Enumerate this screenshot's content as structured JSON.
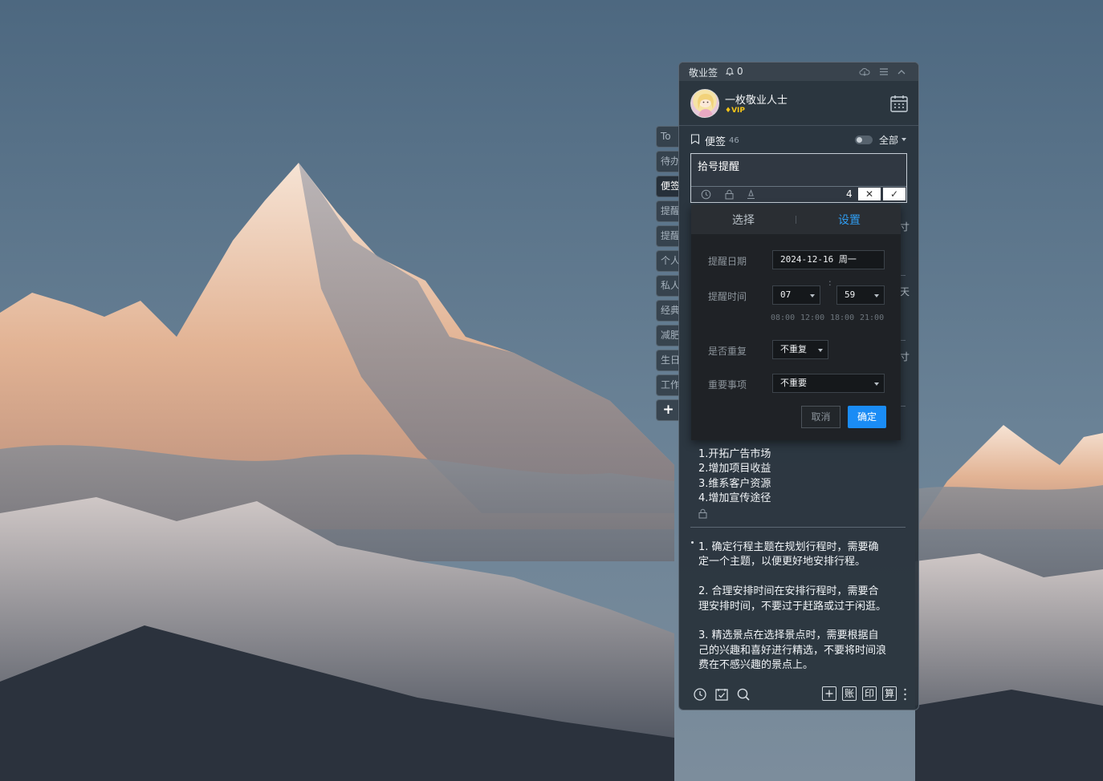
{
  "desktop": {
    "wallpaper": "snow-capped-mountain-peak-at-sunrise"
  },
  "side_tabs": [
    "To",
    "待办",
    "便签",
    "提醒",
    "提醒",
    "个人",
    "私人",
    "经典",
    "减肥",
    "生日",
    "工作",
    "+"
  ],
  "app": {
    "title": "敬业签",
    "notification_count": "0",
    "user": {
      "name": "一枚敬业人士",
      "badge": "VIP"
    },
    "notes_label": "便签",
    "notes_count": "46",
    "filter": "全部",
    "editor": {
      "text": "拾号提醒",
      "char_count": "4",
      "cancel_glyph": "✕",
      "confirm_glyph": "✓"
    },
    "side_fragments": [
      "寸",
      "天",
      "寸"
    ],
    "reminder_popup": {
      "tabs": [
        "选择",
        "设置"
      ],
      "active_tab": "设置",
      "date_label": "提醒日期",
      "date_value": "2024-12-16 周一",
      "time_label": "提醒时间",
      "hour": "07",
      "minute": "59",
      "time_separator": ":",
      "quick_times": [
        "08:00",
        "12:00",
        "18:00",
        "21:00"
      ],
      "repeat_label": "是否重复",
      "repeat_value": "不重复",
      "importance_label": "重要事项",
      "importance_value": "不重要",
      "cancel": "取消",
      "confirm": "确定"
    },
    "notes": [
      {
        "lines": [
          "1.开拓广告市场",
          "2.增加项目收益",
          "3.维系客户资源",
          "4.增加宣传途径"
        ]
      },
      {
        "lines": [
          "1. 确定行程主题在规划行程时，需要确",
          "定一个主题，以便更好地安排行程。",
          "2. 合理安排时间在安排行程时，需要合",
          "理安排时间，不要过于赶路或过于闲逛。",
          "3. 精选景点在选择景点时，需要根据自",
          "己的兴趣和喜好进行精选，不要将时间浪",
          "费在不感兴趣的景点上。"
        ]
      }
    ],
    "bottom_bar": {
      "chars": [
        "账",
        "印",
        "算"
      ]
    },
    "accent_color": "#1a8cf5"
  }
}
